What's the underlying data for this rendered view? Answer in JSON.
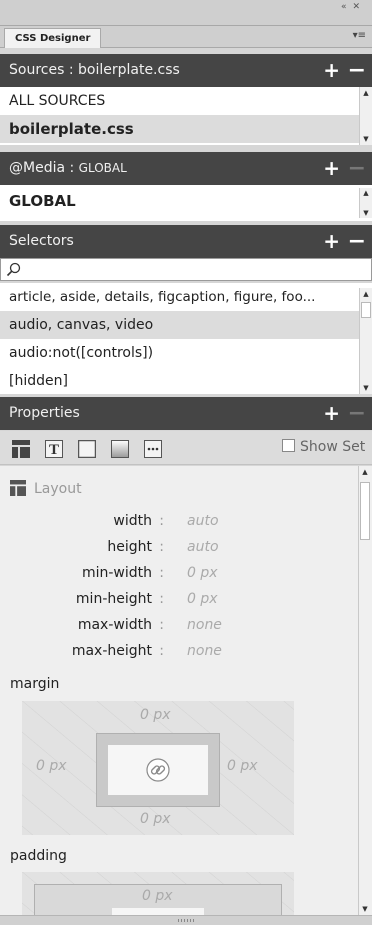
{
  "window": {
    "collapse_icon": "double-chevron-left-icon",
    "close_icon": "close-icon",
    "panel_menu_icon": "panel-menu-icon"
  },
  "tab": {
    "label": "CSS Designer"
  },
  "sources": {
    "header_prefix": "Sources : ",
    "header_file": "boilerplate.css",
    "items": [
      {
        "label": "ALL SOURCES",
        "selected": false
      },
      {
        "label": "boilerplate.css",
        "selected": true
      }
    ]
  },
  "media": {
    "header_prefix": "@Media : ",
    "header_scope": "GLOBAL",
    "items": [
      {
        "label": "GLOBAL",
        "selected": false
      }
    ]
  },
  "selectors": {
    "header": "Selectors",
    "search_value": "",
    "search_icon": "search-icon",
    "items": [
      {
        "label": "article, aside, details, figcaption, figure, foo...",
        "selected": false
      },
      {
        "label": "audio, canvas, video",
        "selected": true
      },
      {
        "label": "audio:not([controls])",
        "selected": false
      },
      {
        "label": "[hidden]",
        "selected": false
      }
    ]
  },
  "properties": {
    "header": "Properties",
    "show_set_label": "Show Set",
    "show_set_checked": false,
    "category_icons": [
      "layout-icon",
      "text-icon",
      "border-icon",
      "background-icon",
      "more-icon"
    ],
    "layout_section": "Layout",
    "layout_props": [
      {
        "name": "width",
        "value": "auto"
      },
      {
        "name": "height",
        "value": "auto"
      },
      {
        "name": "min-width",
        "value": "0 px"
      },
      {
        "name": "min-height",
        "value": "0 px"
      },
      {
        "name": "max-width",
        "value": "none"
      },
      {
        "name": "max-height",
        "value": "none"
      }
    ],
    "colon": ":",
    "margin": {
      "label": "margin",
      "top": "0 px",
      "right": "0 px",
      "bottom": "0 px",
      "left": "0 px",
      "link_icon": "link-icon"
    },
    "padding": {
      "label": "padding",
      "top": "0 px"
    }
  },
  "colors": {
    "header_bg": "#454545",
    "selected_row": "#dcdcdc",
    "panel_bg": "#efefef"
  }
}
